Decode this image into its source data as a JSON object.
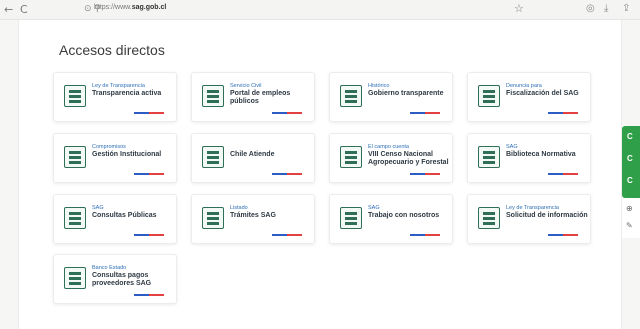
{
  "browser": {
    "back": "←",
    "reload": "C",
    "url_prefix": "https://www.",
    "url_domain": "sag.gob.cl",
    "security_icon": "lock-icon",
    "bookmark_icon": "star-icon",
    "toolbar_icons": [
      "shield-icon",
      "download-icon",
      "share-icon"
    ]
  },
  "page": {
    "title": "Accesos directos"
  },
  "cards": [
    {
      "sub": "Ley de Transparencia",
      "main": "Transparencia activa",
      "icon": "hand-shake-icon"
    },
    {
      "sub": "Servicio Civil",
      "main": "Portal de empleos públicos",
      "icon": "document-icon"
    },
    {
      "sub": "Histórico",
      "main": "Gobierno transparente",
      "icon": "search-document-icon"
    },
    {
      "sub": "Denuncia para",
      "main": "Fiscalización del SAG",
      "icon": "checklist-icon"
    },
    {
      "sub": "Compromisos",
      "main": "Gestión Institucional",
      "icon": "id-card-icon"
    },
    {
      "sub": "",
      "main": "Chile Atiende",
      "icon": "people-icon"
    },
    {
      "sub": "El campo cuenta",
      "main": "VIII Censo Nacional Agropecuario y Forestal",
      "icon": "plant-icon"
    },
    {
      "sub": "SAG",
      "main": "Biblioteca Normativa",
      "icon": "book-icon"
    },
    {
      "sub": "SAG",
      "main": "Consultas Públicas",
      "icon": "chat-icon"
    },
    {
      "sub": "Listado",
      "main": "Trámites SAG",
      "icon": "form-icon"
    },
    {
      "sub": "SAG",
      "main": "Trabajo con nosotros",
      "icon": "briefcase-icon"
    },
    {
      "sub": "Ley de Transparencia",
      "main": "Solicitud de información",
      "icon": "info-icon"
    },
    {
      "sub": "Banco Estado",
      "main": "Consultas pagos proveedores SAG",
      "icon": "bank-icon"
    }
  ],
  "side_panel": {
    "tab_glyphs": [
      "C",
      "C",
      "C"
    ],
    "extra_glyphs": [
      "⊕",
      "✎"
    ]
  },
  "colors": {
    "accent_blue": "#2d5cc5",
    "accent_red": "#e34141",
    "icon_green": "#2f6f57"
  }
}
